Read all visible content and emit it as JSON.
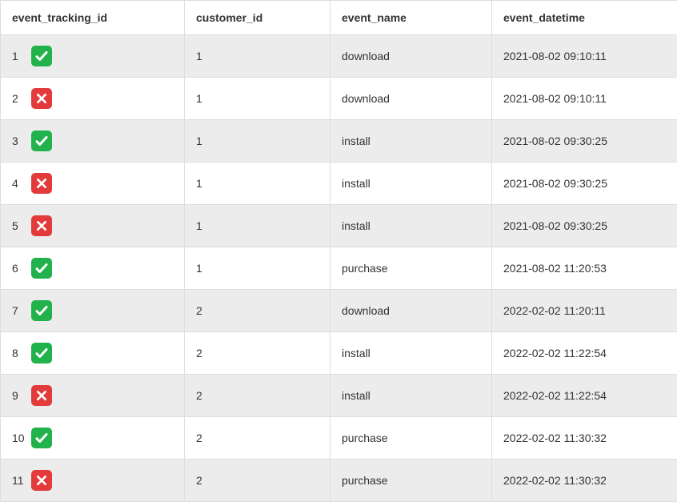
{
  "columns": [
    "event_tracking_id",
    "customer_id",
    "event_name",
    "event_datetime"
  ],
  "status_icons": {
    "ok": "check-icon",
    "no": "cross-icon"
  },
  "colors": {
    "ok": "#22b24c",
    "no": "#e33b3b"
  },
  "rows": [
    {
      "id": "1",
      "status": "ok",
      "customer_id": "1",
      "event_name": "download",
      "event_datetime": "2021-08-02 09:10:11"
    },
    {
      "id": "2",
      "status": "no",
      "customer_id": "1",
      "event_name": "download",
      "event_datetime": "2021-08-02 09:10:11"
    },
    {
      "id": "3",
      "status": "ok",
      "customer_id": "1",
      "event_name": "install",
      "event_datetime": "2021-08-02 09:30:25"
    },
    {
      "id": "4",
      "status": "no",
      "customer_id": "1",
      "event_name": "install",
      "event_datetime": "2021-08-02 09:30:25"
    },
    {
      "id": "5",
      "status": "no",
      "customer_id": "1",
      "event_name": "install",
      "event_datetime": "2021-08-02 09:30:25"
    },
    {
      "id": "6",
      "status": "ok",
      "customer_id": "1",
      "event_name": "purchase",
      "event_datetime": "2021-08-02 11:20:53"
    },
    {
      "id": "7",
      "status": "ok",
      "customer_id": "2",
      "event_name": "download",
      "event_datetime": "2022-02-02 11:20:11"
    },
    {
      "id": "8",
      "status": "ok",
      "customer_id": "2",
      "event_name": "install",
      "event_datetime": "2022-02-02 11:22:54"
    },
    {
      "id": "9",
      "status": "no",
      "customer_id": "2",
      "event_name": "install",
      "event_datetime": "2022-02-02 11:22:54"
    },
    {
      "id": "10",
      "status": "ok",
      "customer_id": "2",
      "event_name": "purchase",
      "event_datetime": "2022-02-02 11:30:32"
    },
    {
      "id": "11",
      "status": "no",
      "customer_id": "2",
      "event_name": "purchase",
      "event_datetime": "2022-02-02 11:30:32"
    }
  ]
}
